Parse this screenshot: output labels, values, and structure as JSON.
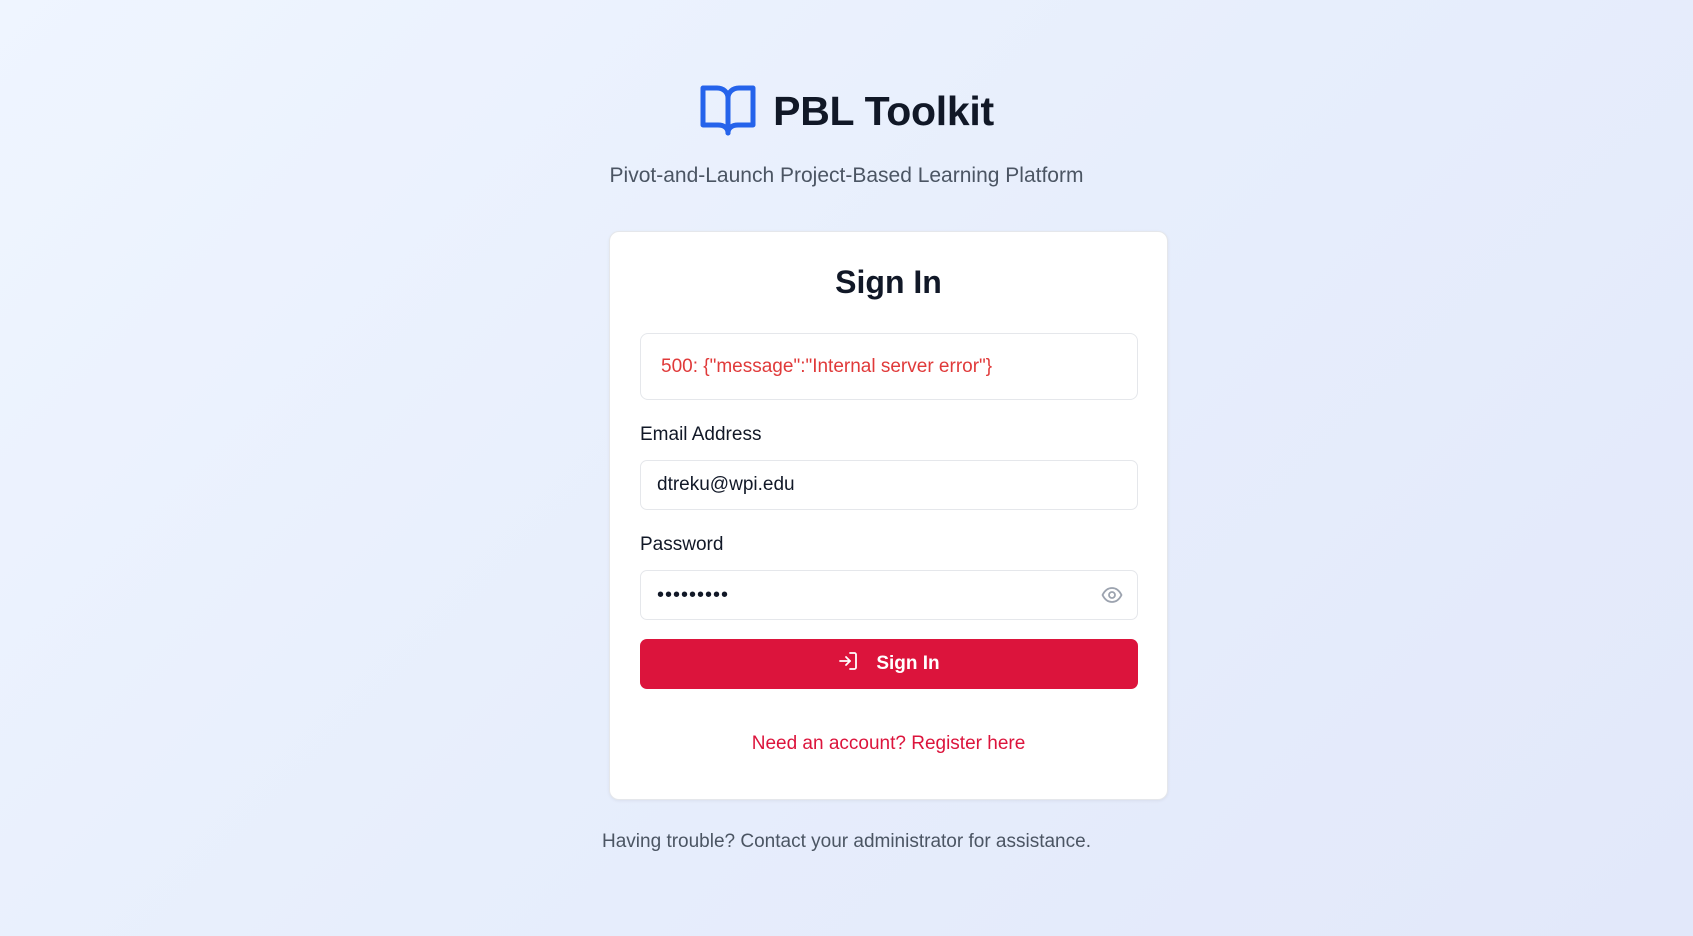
{
  "brand": {
    "icon": "book-open-icon",
    "title": "PBL Toolkit",
    "subtitle": "Pivot-and-Launch Project-Based Learning Platform",
    "accent_color": "#2563eb"
  },
  "card": {
    "title": "Sign In",
    "error_message": "500: {\"message\":\"Internal server error\"}",
    "error_color": "#e03a3a",
    "email": {
      "label": "Email Address",
      "value": "dtreku@wpi.edu"
    },
    "password": {
      "label": "Password",
      "masked_value": "•••••••••",
      "toggle_icon": "eye-icon"
    },
    "submit": {
      "label": "Sign In",
      "icon": "log-in-icon",
      "color": "#dc143c"
    },
    "register_link": "Need an account? Register here"
  },
  "footer": {
    "text": "Having trouble? Contact your administrator for assistance."
  }
}
